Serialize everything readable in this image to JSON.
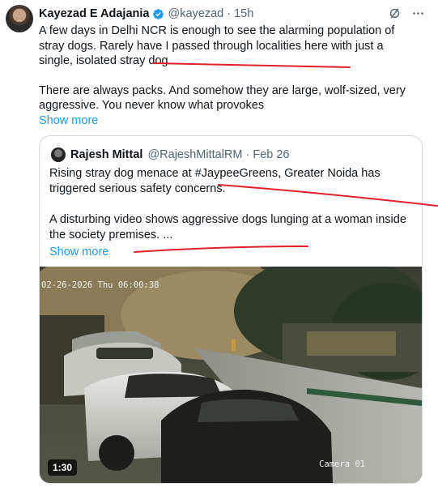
{
  "tweet": {
    "author_name": "Kayezad E Adajania",
    "author_handle": "@kayezad",
    "time": "· 15h",
    "text_p1": "A few days in Delhi NCR is enough to see the alarming population of stray dogs. Rarely have I passed through localities here with just a single, isolated stray dog.",
    "text_p2": "There are always packs. And somehow they are large, wolf-sized, very aggressive. You never know what provokes",
    "show_more": "Show more",
    "grok_icon": "slash-circle-icon",
    "more_icon": "ellipsis-icon"
  },
  "quote": {
    "author_name": "Rajesh Mittal",
    "author_handle": "@RajeshMittalRM",
    "time": "· Feb 26",
    "text_p1": "Rising stray dog menace at #JaypeeGreens, Greater Noida has triggered serious safety concerns.",
    "text_p2": "A disturbing video shows aggressive dogs lunging at a woman inside the society premises. ...",
    "show_more": "Show more"
  },
  "video": {
    "timestamp": "02-26-2026 Thu 06:00:38",
    "camera_label": "Camera 01",
    "duration": "1:30"
  },
  "colors": {
    "accent": "#1d9bf0",
    "annotation": "#e0202a",
    "border": "#cfd9de",
    "muted": "#536471"
  }
}
